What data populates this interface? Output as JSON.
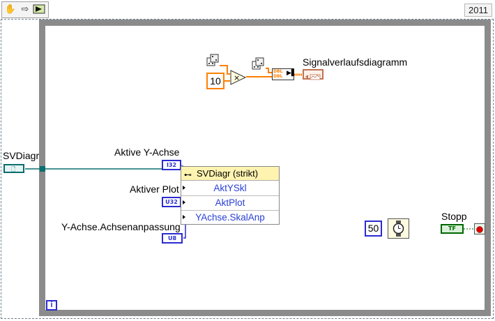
{
  "toolbar": {
    "run_icon": "run-arrow-icon",
    "pause_icon": "grab-hand-icon",
    "step_icon": "step-arrow-icon"
  },
  "version": "2011",
  "controls": {
    "svdiagr_label": "SVDiagr",
    "aktive_y_label": "Aktive Y-Achse",
    "aktive_y_type": "I32",
    "aktiver_plot_label": "Aktiver Plot",
    "aktiver_plot_type": "U32",
    "y_achse_label": "Y-Achse.Achsenanpassung",
    "y_achse_type": "U8",
    "stopp_label": "Stopp",
    "stopp_type": "TF"
  },
  "constants": {
    "ten": "10",
    "fifty": "50"
  },
  "chart": {
    "label": "Signalverlaufsdiagramm",
    "dbl1": "DBL",
    "dbl2": "DBL"
  },
  "property_node": {
    "title": "SVDiagr (strikt)",
    "props": [
      "AktYSkl",
      "AktPlot",
      "YAchse.SkalAnp"
    ]
  },
  "loop_iteration": "i",
  "colors": {
    "wire_ref": "#0a6e6e",
    "wire_dbl": "#ff8000",
    "wire_int": "#2b2bd0",
    "wire_bool": "#006600",
    "loop": "#8b8b8b"
  }
}
